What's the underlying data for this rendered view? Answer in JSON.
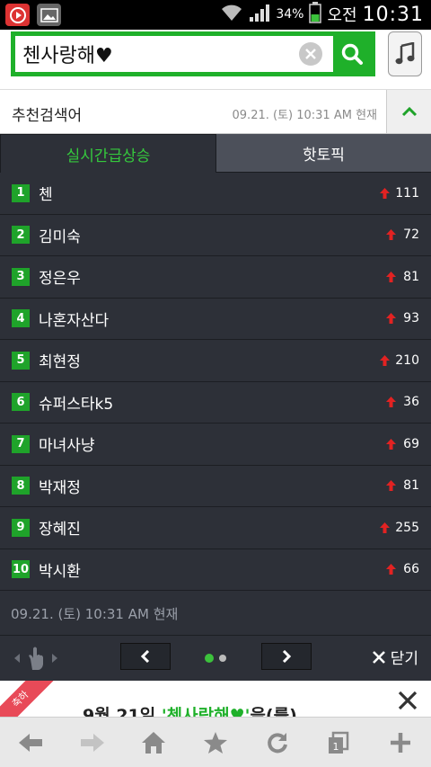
{
  "status_bar": {
    "battery_percent": "34%",
    "ampm": "오전",
    "time": "10:31"
  },
  "search": {
    "query": "첸사랑해♥"
  },
  "recommend": {
    "title": "추천검색어",
    "updated": "09.21. (토) 10:31 AM 현재"
  },
  "tabs": [
    {
      "label": "실시간급상승",
      "active": true
    },
    {
      "label": "핫토픽",
      "active": false
    }
  ],
  "ranking": [
    {
      "rank": "1",
      "keyword": "첸",
      "change": "111"
    },
    {
      "rank": "2",
      "keyword": "김미숙",
      "change": "72"
    },
    {
      "rank": "3",
      "keyword": "정은우",
      "change": "81"
    },
    {
      "rank": "4",
      "keyword": "나혼자산다",
      "change": "93"
    },
    {
      "rank": "5",
      "keyword": "최현정",
      "change": "210"
    },
    {
      "rank": "6",
      "keyword": "슈퍼스타k5",
      "change": "36"
    },
    {
      "rank": "7",
      "keyword": "마녀사냥",
      "change": "69"
    },
    {
      "rank": "8",
      "keyword": "박재정",
      "change": "81"
    },
    {
      "rank": "9",
      "keyword": "장혜진",
      "change": "255"
    },
    {
      "rank": "10",
      "keyword": "박시환",
      "change": "66"
    }
  ],
  "footer_time": "09.21. (토) 10:31 AM 현재",
  "pager": {
    "close_label": "닫기",
    "current_page": 1,
    "total_pages": 2
  },
  "banner": {
    "ribbon": "축하",
    "prefix": "9월 21일 ",
    "highlight": "'첸사랑해♥'",
    "suffix": "을(를)"
  },
  "colors": {
    "accent": "#1fb02a",
    "list_bg": "#2d3038",
    "arrow": "#e22222"
  }
}
